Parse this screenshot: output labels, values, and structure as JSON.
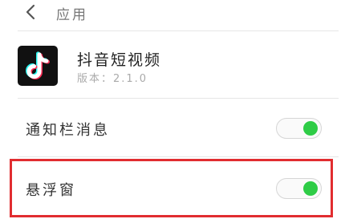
{
  "header": {
    "title": "应用",
    "back_icon": "chevron-left-icon"
  },
  "app": {
    "name": "抖音短视频",
    "version": "版本：2.1.0",
    "icon": "tiktok-logo"
  },
  "settings": [
    {
      "label": "通知栏消息",
      "enabled": true
    },
    {
      "label": "悬浮窗",
      "enabled": true
    }
  ],
  "colors": {
    "toggle_on": "#2ecc46",
    "highlight": "#e12d30",
    "app_icon_bg": "#111111",
    "logo_cyan": "#25f4ee",
    "logo_red": "#fe2c55"
  }
}
